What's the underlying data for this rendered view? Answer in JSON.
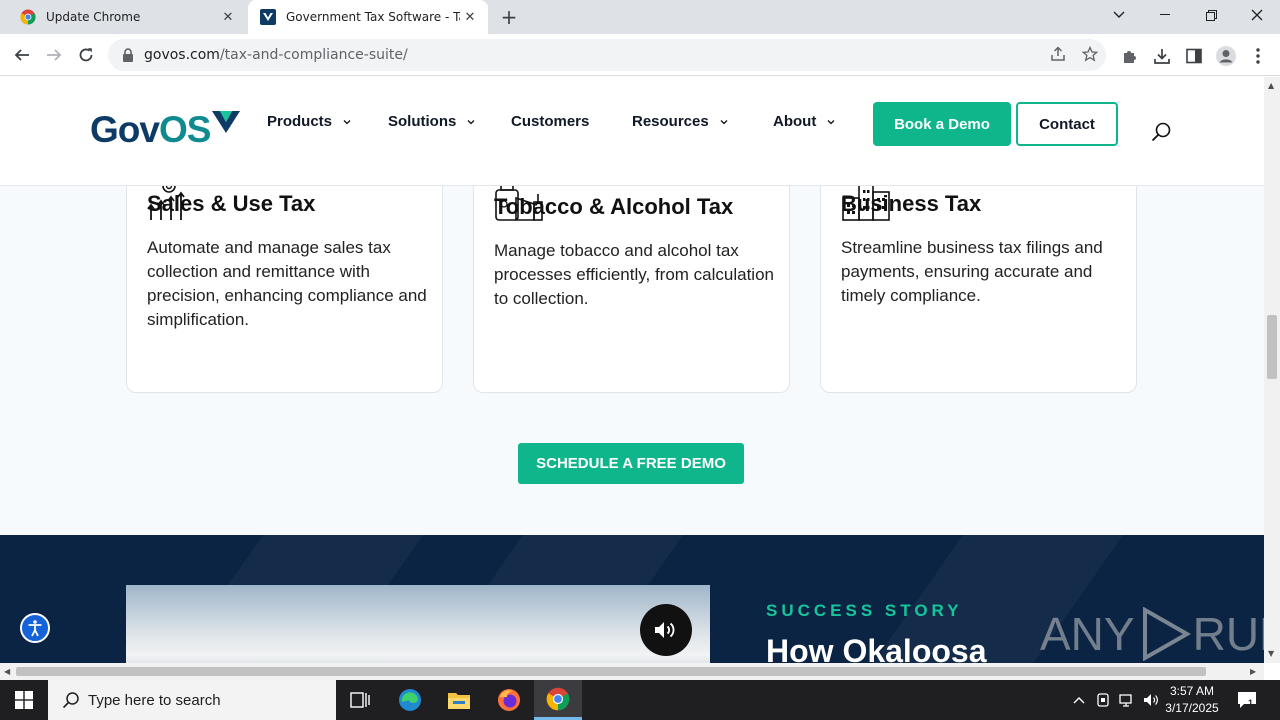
{
  "browser": {
    "tabs": [
      {
        "title": "Update Chrome",
        "active": false
      },
      {
        "title": "Government Tax Software - Tax &",
        "active": true
      }
    ],
    "new_tab_glyph": "+",
    "url_host": "govos.com",
    "url_path": "/tax-and-compliance-suite/"
  },
  "site": {
    "logo_gov": "Gov",
    "logo_os": "OS",
    "nav": [
      {
        "label": "Products",
        "has_dropdown": true
      },
      {
        "label": "Solutions",
        "has_dropdown": true
      },
      {
        "label": "Customers",
        "has_dropdown": false
      },
      {
        "label": "Resources",
        "has_dropdown": true
      },
      {
        "label": "About",
        "has_dropdown": true
      }
    ],
    "book_demo_label": "Book a Demo",
    "contact_label": "Contact",
    "brand_color": "#0fb68c",
    "navy_color": "#0b2443"
  },
  "cards": [
    {
      "icon": "growth-chart-icon",
      "title": "Sales & Use Tax",
      "body": "Automate and manage sales tax collection and remittance with precision, enhancing compliance and simplification."
    },
    {
      "icon": "tobacco-alcohol-icon",
      "title": "Tobacco & Alcohol Tax",
      "body": "Manage tobacco and alcohol tax processes efficiently, from calculation to collection."
    },
    {
      "icon": "city-buildings-icon",
      "title": "Business Tax",
      "body": "Streamline business tax filings and payments, ensuring accurate and timely compliance."
    }
  ],
  "cta_label": "SCHEDULE A FREE DEMO",
  "success": {
    "eyebrow": "SUCCESS STORY",
    "title": "How Okaloosa"
  },
  "watermark": {
    "left": "ANY",
    "right": "RUN"
  },
  "taskbar": {
    "search_placeholder": "Type here to search",
    "time": "3:57 AM",
    "date": "3/17/2025",
    "notification_count": "1"
  }
}
